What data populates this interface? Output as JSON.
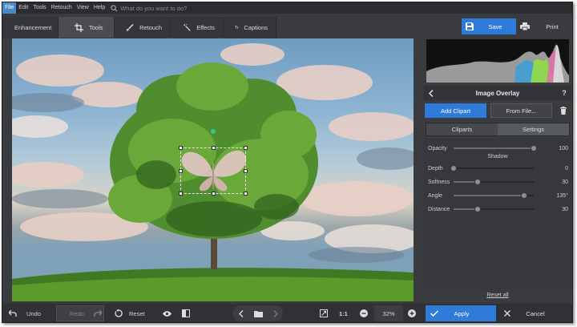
{
  "menu": [
    "File",
    "Edit",
    "Tools",
    "Retouch",
    "View",
    "Help"
  ],
  "search": {
    "placeholder": "What do you want to do?"
  },
  "toolbar": {
    "enhancement": "Enhancement",
    "tools": "Tools",
    "retouch": "Retouch",
    "effects": "Effects",
    "captions": "Captions"
  },
  "header": {
    "save": "Save",
    "print": "Print"
  },
  "panel": {
    "title": "Image Overlay",
    "help": "?",
    "add_clipart": "Add Clipart",
    "from_file": "From File...",
    "tabs": {
      "cliparts": "Cliparts",
      "settings": "Settings"
    },
    "shadow_title": "Shadow",
    "sliders": {
      "opacity": {
        "label": "Opacity",
        "value": "100",
        "level": 1.0
      },
      "depth": {
        "label": "Depth",
        "value": "0",
        "level": 0.0
      },
      "softness": {
        "label": "Softness",
        "value": "30",
        "level": 0.3
      },
      "angle": {
        "label": "Angle",
        "value": "135°",
        "level": 0.875
      },
      "distance": {
        "label": "Distance",
        "value": "30",
        "level": 0.3
      }
    },
    "reset_all": "Reset all"
  },
  "bottom": {
    "undo": "Undo",
    "redo": "Redo",
    "reset": "Reset",
    "ratio": "1:1",
    "zoom": "32%",
    "apply": "Apply",
    "cancel": "Cancel"
  },
  "colors": {
    "accent": "#2f7bd9",
    "background": "#3a3b3f",
    "selection_handle": "#3cc48a"
  }
}
